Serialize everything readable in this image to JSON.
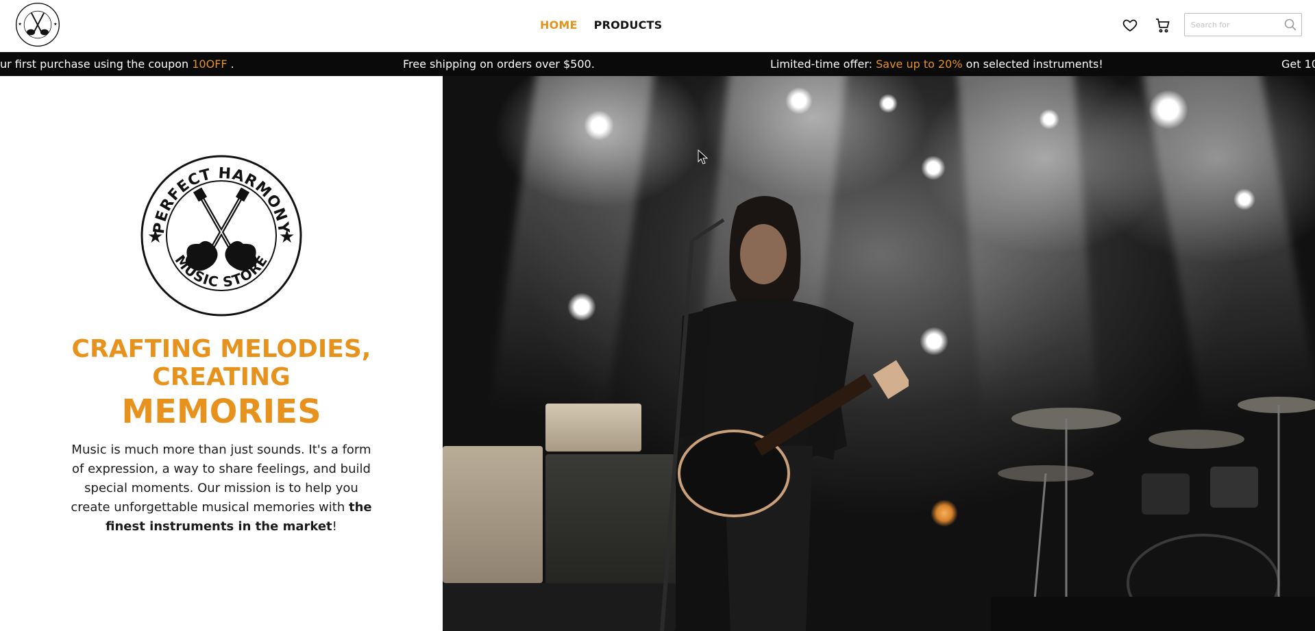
{
  "store": {
    "logo_text_top": "PERFECT HARMONY",
    "logo_text_bottom": "MUSIC STORE"
  },
  "nav": {
    "home": "HOME",
    "products": "PRODUCTS"
  },
  "header": {
    "wishlist_icon": "heart-icon",
    "cart_icon": "cart-icon",
    "search_placeholder": "Search for",
    "search_icon": "search-icon"
  },
  "ticker": {
    "item1_prefix": "ur first purchase using the coupon ",
    "item1_code": "10OFF",
    "item1_suffix": " .",
    "item2": "Free shipping on orders over $500.",
    "item3_prefix": "Limited-time offer: ",
    "item3_highlight": "Save up to 20%",
    "item3_suffix": " on selected instruments!",
    "item4": "Get 10"
  },
  "hero": {
    "headline_line1": "CRAFTING MELODIES,",
    "headline_line2": "CREATING",
    "headline_line3": "MEMORIES",
    "description": "Music is much more than just sounds. It's a form of expression, a way to share feelings, and build special moments. Our mission is to help you create unforgettable musical memories with ",
    "description_bold": "the finest instruments in the market",
    "description_end": "!"
  },
  "colors": {
    "accent": "#e8921e",
    "ticker_bg": "#0a0a0a",
    "text": "#111111"
  }
}
